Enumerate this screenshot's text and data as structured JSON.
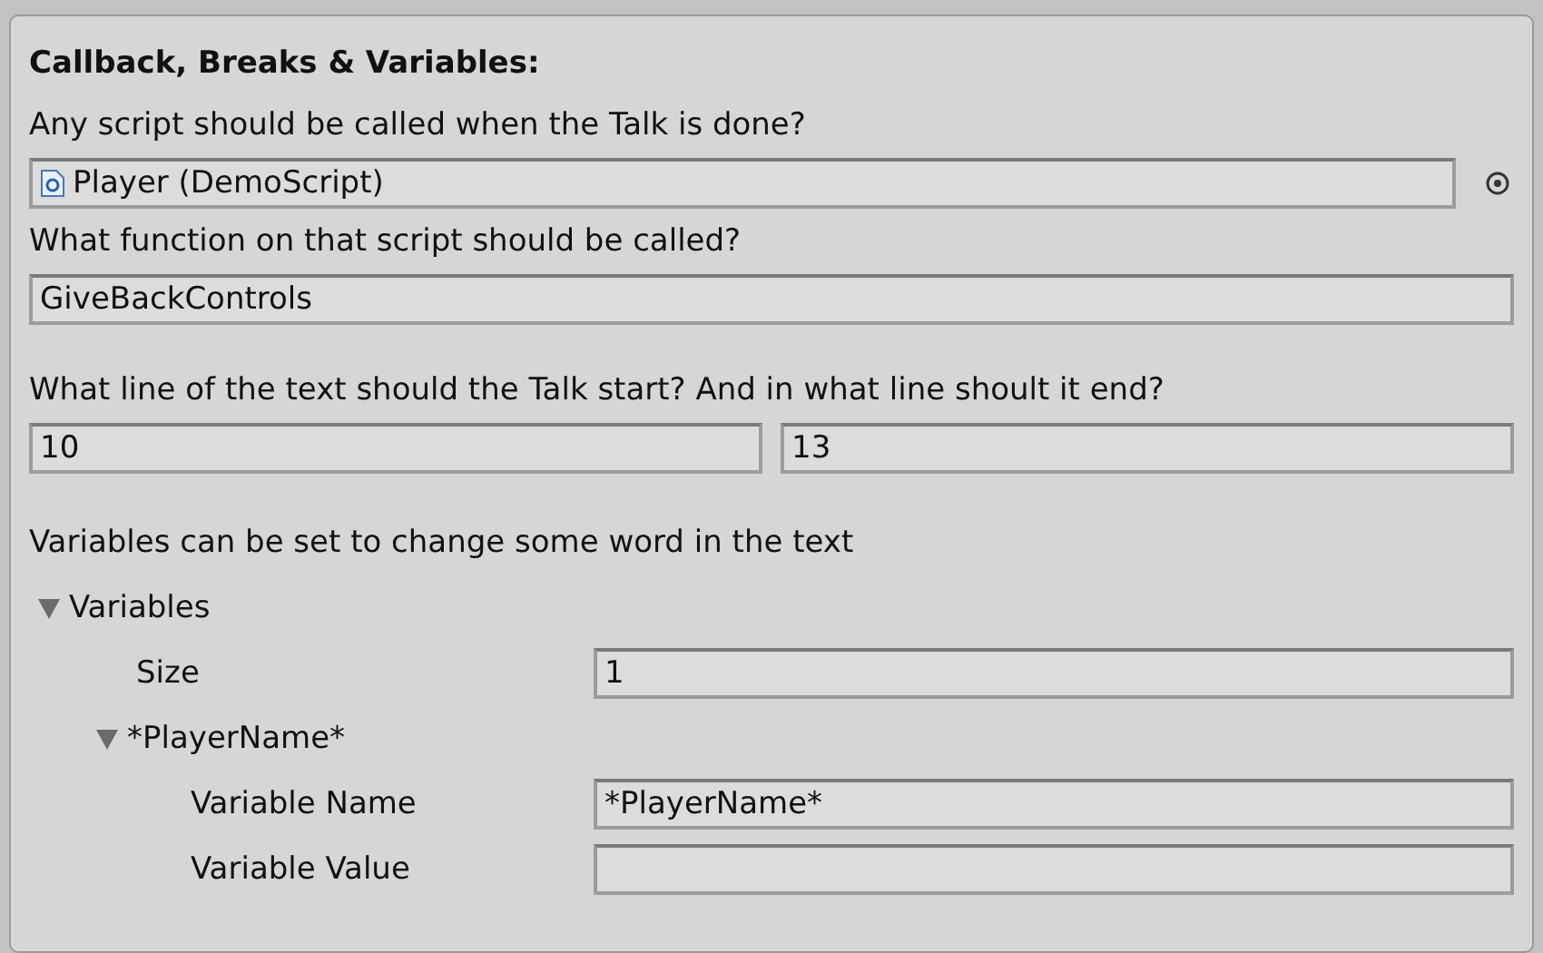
{
  "section": {
    "title": "Callback, Breaks & Variables:"
  },
  "script_field": {
    "label": "Any script should be called when the Talk is done?",
    "value": "Player (DemoScript)"
  },
  "function_field": {
    "label": "What function on that script should be called?",
    "value": "GiveBackControls"
  },
  "line_range": {
    "label": "What line of the text should the Talk start? And in what line shoult it end?",
    "start": "10",
    "end": "13"
  },
  "variables": {
    "label": "Variables can be set to change some word in the text",
    "tree": {
      "label": "Variables",
      "expanded": true,
      "size": {
        "label": "Size",
        "value": "1"
      },
      "elements": [
        {
          "label": "*PlayerName*",
          "expanded": true,
          "fields": [
            {
              "label": "Variable Name",
              "value": "*PlayerName*"
            },
            {
              "label": "Variable Value"
            }
          ]
        }
      ]
    }
  }
}
